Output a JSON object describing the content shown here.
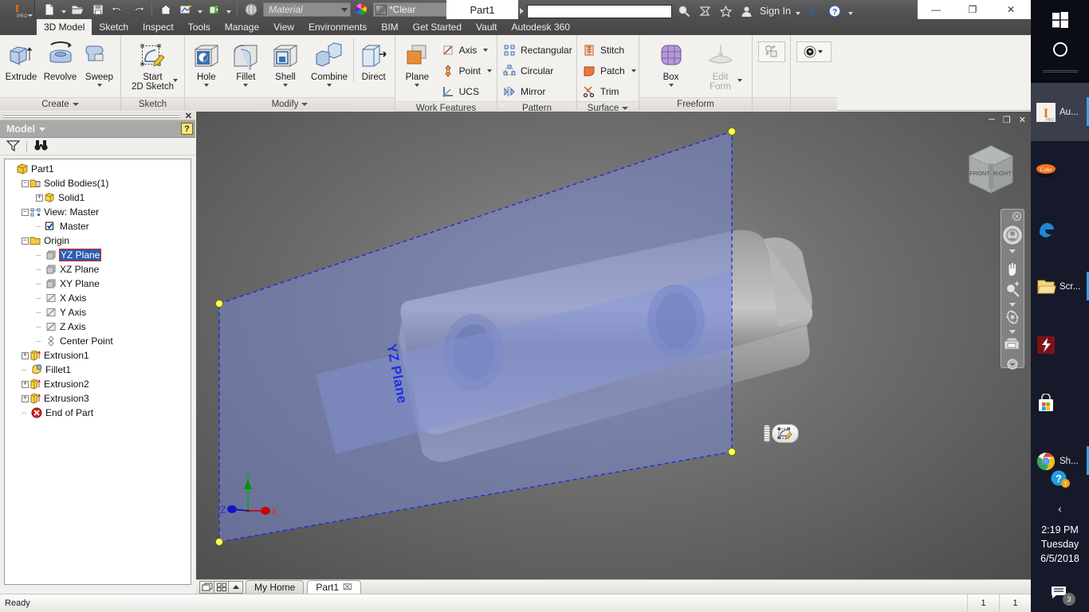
{
  "app": {
    "product": "PRO",
    "document_title": "Part1",
    "sign_in": "Sign In",
    "material_placeholder": "Material",
    "appearance_value": "*Clear",
    "search_value": ""
  },
  "window_controls": {
    "minimize": "—",
    "restore": "❐",
    "close": "✕"
  },
  "quick_access": [
    {
      "name": "new-file",
      "icon": "new-file-icon",
      "has_dropdown": true
    },
    {
      "name": "open-file",
      "icon": "open-folder-icon",
      "has_dropdown": false
    },
    {
      "name": "save",
      "icon": "save-icon",
      "has_dropdown": false
    },
    {
      "name": "undo",
      "icon": "undo-arrow-icon",
      "has_dropdown": false
    },
    {
      "name": "redo",
      "icon": "redo-arrow-icon",
      "has_dropdown": false
    },
    {
      "name": "home",
      "icon": "home-icon",
      "has_dropdown": false
    },
    {
      "name": "update",
      "icon": "update-icon",
      "has_dropdown": true
    },
    {
      "name": "return",
      "icon": "return-green-box-icon",
      "has_dropdown": true
    },
    {
      "name": "material-browser",
      "icon": "sphere-material-icon",
      "has_dropdown": false
    },
    {
      "name": "appearance-browser",
      "icon": "color-wheel-icon",
      "has_dropdown": false
    }
  ],
  "ribbon": {
    "tabs": [
      {
        "label": "3D Model",
        "active": true
      },
      {
        "label": "Sketch",
        "active": false
      },
      {
        "label": "Inspect",
        "active": false
      },
      {
        "label": "Tools",
        "active": false
      },
      {
        "label": "Manage",
        "active": false
      },
      {
        "label": "View",
        "active": false
      },
      {
        "label": "Environments",
        "active": false
      },
      {
        "label": "BIM",
        "active": false
      },
      {
        "label": "Get Started",
        "active": false
      },
      {
        "label": "Vault",
        "active": false
      },
      {
        "label": "Autodesk 360",
        "active": false
      }
    ],
    "panels": [
      {
        "title": "Create",
        "has_title_caret": true,
        "buttons": [
          {
            "label": "Extrude",
            "icon": "extrude-icon",
            "dropdown": false
          },
          {
            "label": "Revolve",
            "icon": "revolve-icon",
            "dropdown": false
          },
          {
            "label": "Sweep",
            "icon": "sweep-icon",
            "dropdown": true
          }
        ]
      },
      {
        "title": "Sketch",
        "has_title_caret": false,
        "buttons": [
          {
            "label": "Start\n2D Sketch",
            "icon": "start-2d-sketch-icon",
            "dropdown": true
          }
        ]
      },
      {
        "title": "Modify",
        "has_title_caret": true,
        "buttons": [
          {
            "label": "Hole",
            "icon": "hole-icon",
            "dropdown": true
          },
          {
            "label": "Fillet",
            "icon": "fillet-icon",
            "dropdown": true
          },
          {
            "label": "Shell",
            "icon": "shell-icon",
            "dropdown": true
          },
          {
            "label": "Combine",
            "icon": "combine-icon",
            "dropdown": true
          },
          {
            "label": "Direct",
            "icon": "direct-edit-icon",
            "dropdown": false
          }
        ]
      },
      {
        "title": "Work Features",
        "has_title_caret": false,
        "buttons": [
          {
            "label": "Plane",
            "icon": "work-plane-icon",
            "dropdown": true
          }
        ],
        "small_buttons": [
          {
            "label": "Axis",
            "icon": "work-axis-icon",
            "dropdown": true
          },
          {
            "label": "Point",
            "icon": "work-point-icon",
            "dropdown": true
          },
          {
            "label": "UCS",
            "icon": "ucs-icon",
            "dropdown": false
          }
        ]
      },
      {
        "title": "Pattern",
        "has_title_caret": false,
        "small_buttons": [
          {
            "label": "Rectangular",
            "icon": "rectangular-pattern-icon",
            "dropdown": false
          },
          {
            "label": "Circular",
            "icon": "circular-pattern-icon",
            "dropdown": false
          },
          {
            "label": "Mirror",
            "icon": "mirror-icon",
            "dropdown": false
          }
        ]
      },
      {
        "title": "Surface",
        "has_title_caret": true,
        "small_buttons": [
          {
            "label": "Stitch",
            "icon": "stitch-icon",
            "dropdown": false
          },
          {
            "label": "Patch",
            "icon": "patch-icon",
            "dropdown": true
          },
          {
            "label": "Trim",
            "icon": "trim-scissors-icon",
            "dropdown": false
          }
        ]
      },
      {
        "title": "Freeform",
        "has_title_caret": false,
        "buttons": [
          {
            "label": "Box",
            "icon": "freeform-box-icon",
            "dropdown": true
          },
          {
            "label": "Edit\nForm",
            "icon": "edit-form-icon",
            "dropdown": true,
            "disabled": true
          }
        ]
      }
    ]
  },
  "browser": {
    "panel_title": "Model",
    "help_label": "?",
    "tools": [
      {
        "name": "filter-icon"
      },
      {
        "name": "find-binoculars-icon"
      }
    ],
    "tree": [
      {
        "label": "Part1",
        "indent": 0,
        "icon": "part-box-icon",
        "expander": "none",
        "selected": false
      },
      {
        "label": "Solid Bodies(1)",
        "indent": 1,
        "icon": "folder-solids-icon",
        "expander": "minus",
        "selected": false
      },
      {
        "label": "Solid1",
        "indent": 2,
        "icon": "solid-body-icon",
        "expander": "plus",
        "selected": false
      },
      {
        "label": "View: Master",
        "indent": 1,
        "icon": "view-master-icon",
        "expander": "minus",
        "selected": false
      },
      {
        "label": "Master",
        "indent": 2,
        "icon": "checkbox-lock-icon",
        "expander": "none",
        "selected": false
      },
      {
        "label": "Origin",
        "indent": 1,
        "icon": "folder-icon",
        "expander": "minus",
        "selected": false
      },
      {
        "label": "YZ Plane",
        "indent": 2,
        "icon": "workplane-icon",
        "expander": "none",
        "selected": true
      },
      {
        "label": "XZ Plane",
        "indent": 2,
        "icon": "workplane-icon",
        "expander": "none",
        "selected": false
      },
      {
        "label": "XY Plane",
        "indent": 2,
        "icon": "workplane-icon",
        "expander": "none",
        "selected": false
      },
      {
        "label": "X Axis",
        "indent": 2,
        "icon": "workaxis-icon",
        "expander": "none",
        "selected": false
      },
      {
        "label": "Y Axis",
        "indent": 2,
        "icon": "workaxis-icon",
        "expander": "none",
        "selected": false
      },
      {
        "label": "Z Axis",
        "indent": 2,
        "icon": "workaxis-icon",
        "expander": "none",
        "selected": false
      },
      {
        "label": "Center Point",
        "indent": 2,
        "icon": "centerpoint-icon",
        "expander": "none",
        "selected": false
      },
      {
        "label": "Extrusion1",
        "indent": 1,
        "icon": "extrusion-icon",
        "expander": "plus",
        "selected": false
      },
      {
        "label": "Fillet1",
        "indent": 1,
        "icon": "fillet-feature-icon",
        "expander": "none",
        "selected": false
      },
      {
        "label": "Extrusion2",
        "indent": 1,
        "icon": "extrusion-icon",
        "expander": "plus",
        "selected": false
      },
      {
        "label": "Extrusion3",
        "indent": 1,
        "icon": "extrusion-icon",
        "expander": "plus",
        "selected": false
      },
      {
        "label": "End of Part",
        "indent": 1,
        "icon": "end-of-part-icon",
        "expander": "none",
        "selected": false
      }
    ]
  },
  "viewport": {
    "plane_label": "YZ Plane",
    "viewcube": {
      "front": "FRONT",
      "right": "RIGHT"
    },
    "axis_triad": {
      "x": "X",
      "y": "Y",
      "z": "Z"
    },
    "colors": {
      "plane_fill": "#6e7fc6",
      "plane_edge": "#2233dd",
      "handle": "#ffff40",
      "background_center": "#8e8e8e",
      "background_edge": "#4c4c4c"
    },
    "navbar_items": [
      {
        "name": "full-navigation-wheel-icon"
      },
      {
        "name": "pan-hand-icon"
      },
      {
        "name": "zoom-magnifier-icon"
      },
      {
        "name": "orbit-icon"
      },
      {
        "name": "look-at-camera-icon"
      }
    ],
    "minitoolbar": [
      {
        "name": "minitoolbar-grip"
      },
      {
        "name": "create-sketch-icon"
      }
    ],
    "window_buttons": {
      "minimize": "─",
      "restore": "❐",
      "close": "✕"
    }
  },
  "doc_tabs": {
    "buttons": [
      {
        "name": "cascade-windows-icon"
      },
      {
        "name": "tile-windows-icon"
      },
      {
        "name": "scroll-up-icon"
      }
    ],
    "tabs": [
      {
        "label": "My Home",
        "active": false,
        "closable": false
      },
      {
        "label": "Part1",
        "active": true,
        "closable": true,
        "close": "⌧"
      }
    ]
  },
  "status_bar": {
    "message": "Ready",
    "cells": [
      "1",
      "1"
    ]
  },
  "taskbar": {
    "start": "start-windows-icon",
    "cortana": "cortana-circle-icon",
    "items": [
      {
        "label": "Au...",
        "icon": "autodesk-inventor-icon",
        "active": true,
        "running": true
      },
      {
        "label": "",
        "icon": "crunchyroll-icon",
        "active": false,
        "running": false
      },
      {
        "label": "",
        "icon": "edge-browser-icon",
        "active": false,
        "running": false
      },
      {
        "label": "Scr...",
        "icon": "folder-yellow-icon",
        "active": false,
        "running": true
      },
      {
        "label": "",
        "icon": "flash-player-icon",
        "active": false,
        "running": false
      },
      {
        "label": "",
        "icon": "microsoft-store-icon",
        "active": false,
        "running": false
      },
      {
        "label": "Sh...",
        "icon": "chrome-browser-icon",
        "active": false,
        "running": true
      }
    ],
    "tray": {
      "help_icon": "help-warning-icon",
      "chevron": "‹",
      "time": "2:19 PM",
      "day": "Tuesday",
      "date": "6/5/2018",
      "action_center_icon": "action-center-icon",
      "notification_count": "3"
    }
  }
}
